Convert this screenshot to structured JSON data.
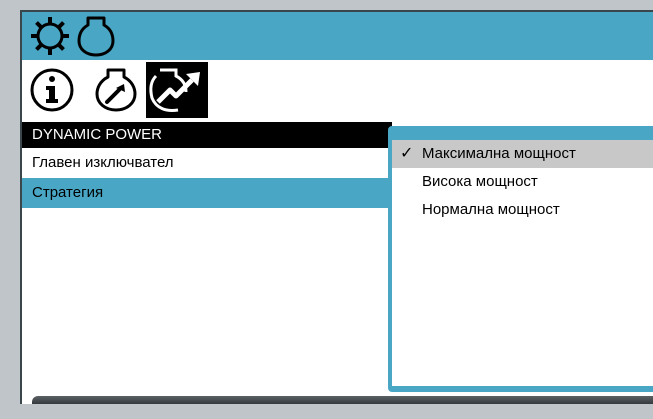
{
  "topbar": {
    "icons": [
      "gear-icon",
      "engine-icon"
    ]
  },
  "tabs": [
    {
      "icon": "info-icon",
      "active": false
    },
    {
      "icon": "engine-wrench-icon",
      "active": false
    },
    {
      "icon": "dynamic-power-icon",
      "active": true
    }
  ],
  "menu": {
    "title": "DYNAMIC POWER",
    "items": [
      {
        "label": "Главен изключвател",
        "selected": false
      },
      {
        "label": "Стратегия",
        "selected": true
      }
    ]
  },
  "popup": {
    "options": [
      {
        "label": "Максимална мощност",
        "checked": true
      },
      {
        "label": "Висока мощност",
        "checked": false
      },
      {
        "label": "Нормална мощност",
        "checked": false
      }
    ],
    "check_glyph": "✓"
  },
  "colors": {
    "accent": "#49a7c5",
    "header": "#000000",
    "checked_bg": "#c8c8c8"
  }
}
